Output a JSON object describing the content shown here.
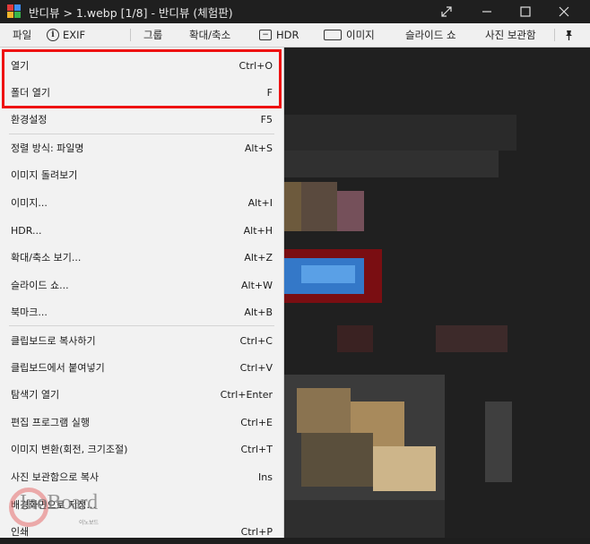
{
  "window": {
    "title": "반디뷰 > 1.webp [1/8] - 반디뷰 (체험판)",
    "controls": [
      "expand-icon",
      "minimize-icon",
      "maximize-icon",
      "close-icon"
    ]
  },
  "toolbar": {
    "file": "파일",
    "exif": "EXIF",
    "group": "그룹",
    "zoom": "확대/축소",
    "hdr": "HDR",
    "image": "이미지",
    "slideshow": "슬라이드 쇼",
    "photo_storage": "사진 보관함"
  },
  "menu": {
    "items": [
      {
        "label": "열기",
        "shortcut": "Ctrl+O"
      },
      {
        "label": "폴더 열기",
        "shortcut": "F"
      },
      {
        "label": "환경설정",
        "shortcut": "F5"
      },
      {
        "label": "정렬 방식: 파일명",
        "shortcut": "Alt+S"
      },
      {
        "label": "이미지 돌려보기",
        "shortcut": ""
      },
      {
        "label": "이미지...",
        "shortcut": "Alt+I"
      },
      {
        "label": "HDR...",
        "shortcut": "Alt+H"
      },
      {
        "label": "확대/축소 보기...",
        "shortcut": "Alt+Z"
      },
      {
        "label": "슬라이드 쇼...",
        "shortcut": "Alt+W"
      },
      {
        "label": "북마크...",
        "shortcut": "Alt+B"
      },
      {
        "label": "클립보드로 복사하기",
        "shortcut": "Ctrl+C"
      },
      {
        "label": "클립보드에서 붙여넣기",
        "shortcut": "Ctrl+V"
      },
      {
        "label": "탐색기 열기",
        "shortcut": "Ctrl+Enter"
      },
      {
        "label": "편집 프로그램 실행",
        "shortcut": "Ctrl+E"
      },
      {
        "label": "이미지 변환(회전, 크기조절)",
        "shortcut": "Ctrl+T"
      },
      {
        "label": "사진 보관함으로 복사",
        "shortcut": "Ins"
      },
      {
        "label": "배경화면으로 지정...",
        "shortcut": ""
      },
      {
        "label": "인쇄",
        "shortcut": "Ctrl+P"
      }
    ]
  },
  "watermark": {
    "text": "InoBoard",
    "sub": "이노보드"
  },
  "colors": {
    "highlight": "#ee1111",
    "menu_bg": "#f2f2f2",
    "titlebar_bg": "#1f1f1f"
  }
}
